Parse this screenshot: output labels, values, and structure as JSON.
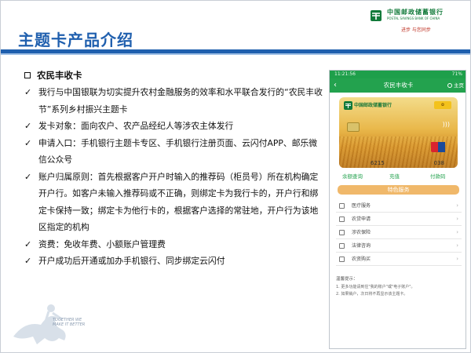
{
  "slide": {
    "title": "主题卡产品介绍",
    "brand": {
      "name_cn": "中国邮政储蓄银行",
      "name_en": "POSTAL SAVINGS BANK OF CHINA",
      "slogan": "进步 与您同步"
    },
    "section_heading": "农民丰收卡",
    "bullets": [
      "我行与中国银联为切实提升农村金融服务的效率和水平联合发行的“农民丰收节”系列乡村振兴主题卡",
      "发卡对象：面向农户、农产品经纪人等涉农主体发行",
      "申请入口：手机银行主题卡专区、手机银行注册页面、云闪付APP、邮乐微信公众号",
      "账户归属原则：首先根据客户开户时输入的推荐码（柜员号）所在机构确定开户行。如客户未输入推荐码或不正确，则绑定卡为我行卡的，开户行和绑定卡保持一致；绑定卡为他行卡的，根据客户选择的常驻地，开户行为该地区指定的机构",
      "资费：免收年费、小额账户管理费",
      "开户成功后开通或加办手机银行、同步绑定云闪付"
    ],
    "watermark_text": "TOGETHER WE MAKE IT BETTER"
  },
  "phone": {
    "time": "11:21:56",
    "signal": "71%",
    "nav_title": "农民丰收卡",
    "home_label": "主页",
    "card": {
      "bank_name": "中国邮政储蓄银行",
      "number_prefix": "6215",
      "number_suffix": "038"
    },
    "actions": [
      "余额查询",
      "充值",
      "付款码"
    ],
    "feature_label": "特色服务",
    "menu": [
      "医疗服务",
      "农贷申请",
      "涉农保险",
      "法律咨询",
      "农资购买"
    ],
    "tip_title": "温馨提示：",
    "tips": [
      "1. 更多功能请到住\"我的账户\"或\"电子账户\"。",
      "2. 如果销户，次日将不再显示该主题卡。"
    ]
  },
  "colors": {
    "title_blue": "#1f5fae",
    "psbc_green": "#23a24e",
    "feature_orange": "#f0b86a"
  }
}
